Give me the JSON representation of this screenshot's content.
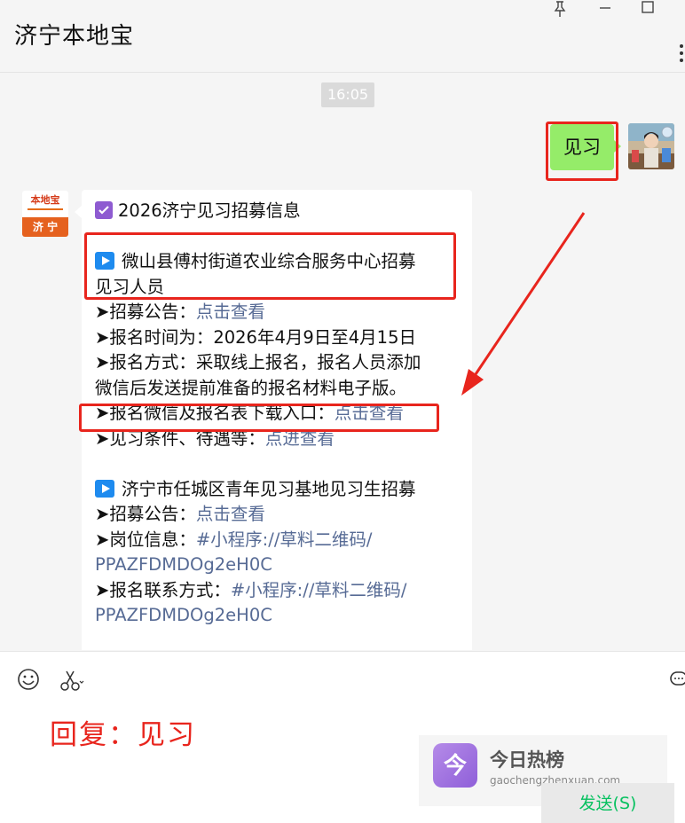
{
  "window": {
    "title": "济宁本地宝"
  },
  "chat": {
    "time": "16:05",
    "self_message": "见习",
    "bot_avatar": {
      "top_text": "本地宝",
      "sub_text": "Bendibao.com",
      "bottom_text": "济 宁"
    },
    "bot_message": {
      "heading": "2026济宁见习招募信息",
      "section1": {
        "title_line1": "微山县傅村街道农业综合服务中心招募",
        "title_line2": "见习人员",
        "notice_label": "➤招募公告：",
        "notice_link": "点击查看",
        "time_line": "➤报名时间为：2026年4月9日至4月15日",
        "method_line1": "➤报名方式：采取线上报名，报名人员添加",
        "method_line2": "微信后发送提前准备的报名材料电子版。",
        "download_label": "➤报名微信及报名表下载入口：",
        "download_link": "点击查看",
        "conditions_label": "➤见习条件、待遇等：",
        "conditions_link": "点进查看"
      },
      "section2": {
        "title": "济宁市任城区青年见习基地见习生招募",
        "notice_label": "➤招募公告：",
        "notice_link": "点击查看",
        "position_label": "➤岗位信息：",
        "position_link1": "#小程序://草料二维码/",
        "position_link2": "PPAZFDMDOg2eH0C",
        "contact_label": "➤报名联系方式：",
        "contact_link1": "#小程序://草料二维码/",
        "contact_link2": "PPAZFDMDOg2eH0C"
      }
    }
  },
  "input": {
    "overlay_text": "回复：见习",
    "send_label": "发送(S)"
  },
  "watermark": {
    "title": "今日热榜",
    "url": "gaochengzhenxuan.com",
    "logo_char": "今"
  },
  "colors": {
    "self_bubble": "#95ec69",
    "link": "#576b95",
    "annotation_red": "#e8251d",
    "send_text": "#07c160"
  }
}
